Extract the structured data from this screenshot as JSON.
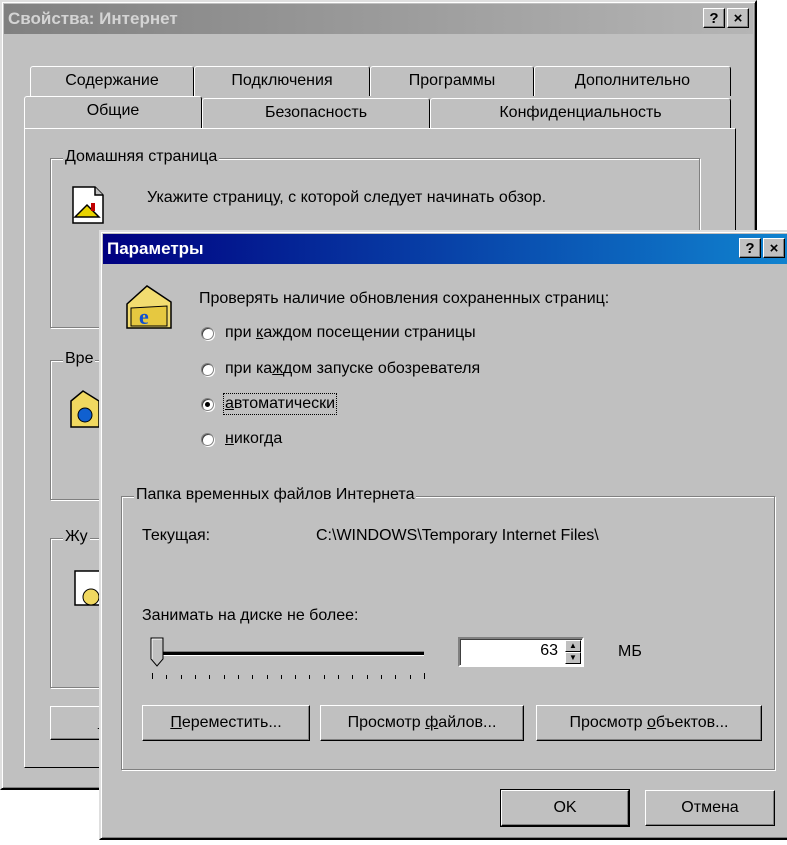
{
  "back_window": {
    "title": "Свойства: Интернет",
    "help_btn": "?",
    "close_btn": "×",
    "tabs_row1": [
      "Содержание",
      "Подключения",
      "Программы",
      "Дополнительно"
    ],
    "tabs_row2": [
      "Общие",
      "Безопасность",
      "Конфиденциальность"
    ],
    "home_group_label": "Домашняя страница",
    "home_instruction": "Укажите страницу, с которой следует начинать обзор.",
    "temp_group_label_visible": "Вре",
    "history_group_label_visible": "Жу",
    "bottom_btn_visible": "I"
  },
  "dialog": {
    "title": "Параметры",
    "help_btn": "?",
    "close_btn": "×",
    "check_header": "Проверять наличие обновления сохраненных страниц:",
    "radios": [
      {
        "pre": "при ",
        "accel": "к",
        "post": "аждом посещении страницы",
        "checked": false
      },
      {
        "pre": "при ка",
        "accel": "ж",
        "post": "дом запуске обозревателя",
        "checked": false
      },
      {
        "pre": "",
        "accel": "а",
        "post": "втоматически",
        "checked": true
      },
      {
        "pre": "",
        "accel": "н",
        "post": "икогда",
        "checked": false
      }
    ],
    "folder_group_label": "Папка временных файлов Интернета",
    "current_label": "Текущая:",
    "current_path": "C:\\WINDOWS\\Temporary Internet Files\\",
    "disk_label_pre": "Занимать на ",
    "disk_label_accel": "д",
    "disk_label_post": "иске не более:",
    "disk_size_value": "63",
    "disk_unit": "МБ",
    "slider_fraction": 0.02,
    "buttons": {
      "move_accel": "П",
      "move_post": "ереместить...",
      "view_files_pre": "Просмотр ",
      "view_files_accel": "ф",
      "view_files_post": "айлов...",
      "view_objects_pre": "Просмотр ",
      "view_objects_accel": "о",
      "view_objects_post": "бъектов...",
      "ok": "OK",
      "cancel": "Отмена"
    }
  }
}
